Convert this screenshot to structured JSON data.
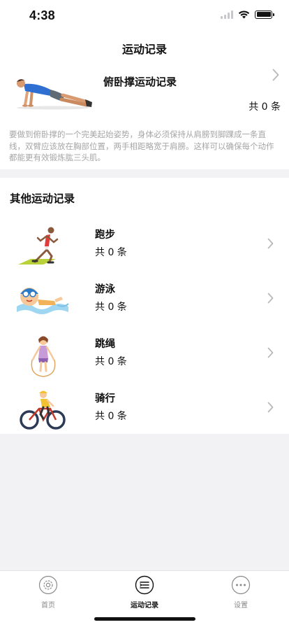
{
  "status_bar": {
    "time": "4:38"
  },
  "nav": {
    "title": "运动记录"
  },
  "featured": {
    "title": "俯卧撑运动记录",
    "count": "共 0 条",
    "description": "要做到俯卧撑的一个完美起始姿势，身体必须保持从肩膀到脚踝成一条直线，双臂应该放在胸部位置，两手相距略宽于肩膀。这样可以确保每个动作都能更有效锻炼肱三头肌。",
    "image": "pushup-illustration"
  },
  "other": {
    "title": "其他运动记录",
    "items": [
      {
        "name": "跑步",
        "count": "共 0 条",
        "icon": "runner-illustration"
      },
      {
        "name": "游泳",
        "count": "共 0 条",
        "icon": "swimmer-illustration"
      },
      {
        "name": "跳绳",
        "count": "共 0 条",
        "icon": "jump-rope-illustration"
      },
      {
        "name": "骑行",
        "count": "共 0 条",
        "icon": "cyclist-illustration"
      }
    ]
  },
  "tabbar": {
    "items": [
      {
        "label": "首页",
        "icon": "home-icon"
      },
      {
        "label": "运动记录",
        "icon": "list-icon"
      },
      {
        "label": "设置",
        "icon": "more-icon"
      }
    ],
    "active": "运动记录"
  }
}
